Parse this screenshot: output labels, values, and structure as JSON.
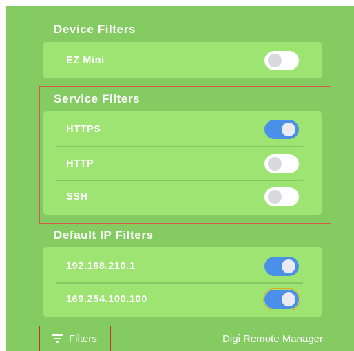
{
  "device_filters": {
    "title": "Device Filters",
    "items": [
      {
        "label": "EZ Mini",
        "enabled": false
      }
    ]
  },
  "service_filters": {
    "title": "Service Filters",
    "items": [
      {
        "label": "HTTPS",
        "enabled": true
      },
      {
        "label": "HTTP",
        "enabled": false
      },
      {
        "label": "SSH",
        "enabled": false
      }
    ]
  },
  "ip_filters": {
    "title": "Default IP Filters",
    "items": [
      {
        "label": "192.168.210.1",
        "enabled": true
      },
      {
        "label": "169.254.100.100",
        "enabled": true
      }
    ]
  },
  "footer": {
    "filters_label": "Filters",
    "filters_icon": "filter-icon",
    "brand": "Digi Remote Manager"
  },
  "colors": {
    "panel_bg": "#84cc62",
    "card_bg": "#9de473",
    "toggle_on": "#4a8fe8",
    "toggle_off": "#ffffff",
    "highlight": "#d65a4a"
  }
}
